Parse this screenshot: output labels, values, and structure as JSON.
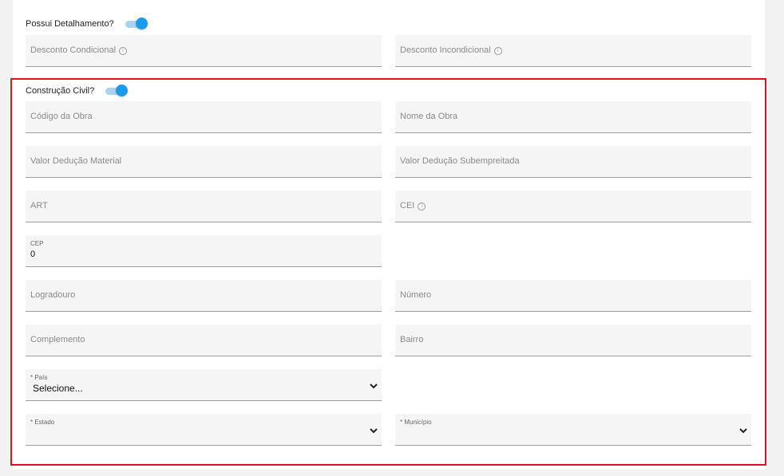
{
  "detalhamento": {
    "label": "Possui Detalhamento?",
    "toggle_on": true,
    "fields": {
      "desconto_condicional": "Desconto Condicional",
      "desconto_incondicional": "Desconto Incondicional"
    }
  },
  "construcao": {
    "label": "Construção Civil?",
    "toggle_on": true,
    "fields": {
      "codigo_obra": "Código da Obra",
      "nome_obra": "Nome da Obra",
      "valor_deducao_material": "Valor Dedução Material",
      "valor_deducao_subempreitada": "Valor Dedução Subempreitada",
      "art": "ART",
      "cei": "CEI",
      "cep_label": "CEP",
      "cep_value": "0",
      "logradouro": "Logradouro",
      "numero": "Número",
      "complemento": "Complemento",
      "bairro": "Bairro",
      "pais_label": "* País",
      "pais_value": "Selecione...",
      "estado_label": "* Estado",
      "estado_value": "",
      "municipio_label": "* Município",
      "municipio_value": ""
    }
  },
  "icons": {
    "info": "info-circle-icon",
    "chevron": "chevron-down-icon"
  },
  "colors": {
    "accent": "#1e9be8",
    "toggle_track": "#a9d3ef",
    "highlight": "#e0101d",
    "field_bg": "#f5f5f5"
  }
}
